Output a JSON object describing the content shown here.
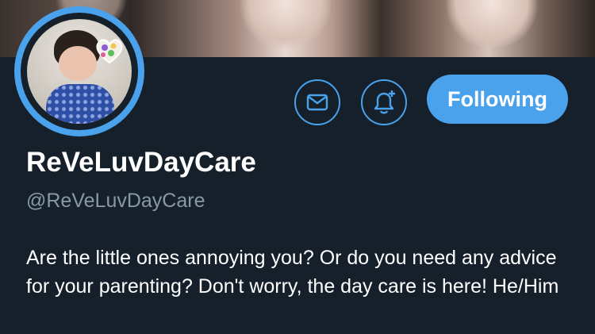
{
  "profile": {
    "display_name": "ReVeLuvDayCare",
    "handle": "@ReVeLuvDayCare",
    "bio": "Are the little ones annoying you? Or do you need any advice for your parenting? Don't worry, the day care is here! He/Him"
  },
  "actions": {
    "message_icon": "envelope-icon",
    "notify_icon": "bell-plus-icon",
    "follow_label": "Following"
  },
  "colors": {
    "background": "#15202b",
    "accent": "#4aa1ec",
    "secondary_text": "#8899a6",
    "primary_text": "#ffffff"
  }
}
